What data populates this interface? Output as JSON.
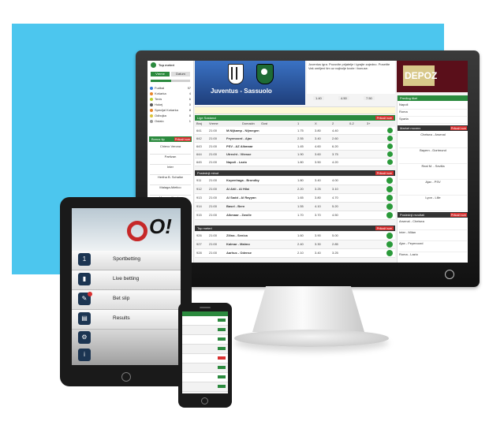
{
  "monitor": {
    "sidebar": {
      "title": "Top meteri",
      "tabs": [
        "Vreme",
        "Datum"
      ],
      "sports": [
        {
          "name": "Fudbal",
          "count": "87"
        },
        {
          "name": "Košarka",
          "count": "4"
        },
        {
          "name": "Tenis",
          "count": "6"
        },
        {
          "name": "Hokej",
          "count": "0"
        },
        {
          "name": "Specijal Košarka",
          "count": "8"
        },
        {
          "name": "Odbojka",
          "count": "8"
        },
        {
          "name": "Ostalo",
          "count": "1"
        }
      ],
      "bet_slip_title": "Bonus tip",
      "bet_slip_button": "Prikaži sve",
      "bet_slip_rows": [
        "Chievo Verona",
        "Partizan",
        "Inter",
        "Hertha B. Schalke",
        "Malaga Atletico",
        "Monaco Nantes"
      ]
    },
    "banner": {
      "match_title": "Juventus - Sassuolo",
      "promo_text": "Juventus igra. Pozovite prijatelje i igrajte zajedno. Posetite Vaš omiljeni tim uz najbolje kvote i bonuse.",
      "odds": [
        "1.40",
        "4.50",
        "7.50"
      ],
      "ad_text": "DEPOZ"
    },
    "sections": [
      {
        "title": "Lige Sastanci",
        "button": "Prikaži sve"
      },
      {
        "title": "Poslednji minut",
        "button": "Prikaži sve"
      },
      {
        "title": "Top meteri",
        "button": "Prikaži sve"
      }
    ],
    "table_header": [
      "Broj",
      "Vreme",
      "Domaćin",
      "Gost",
      "1",
      "X",
      "2",
      "0-2",
      "3+"
    ],
    "rows_top": [
      {
        "num": "641",
        "time": "21:00",
        "match": "M.Nijkamp - Nijmegen",
        "odds": [
          "1.75",
          "3.80",
          "4.40"
        ]
      },
      {
        "num": "642",
        "time": "21:00",
        "match": "Feyenoord - Ajax",
        "odds": [
          "2.55",
          "3.40",
          "2.60"
        ]
      },
      {
        "num": "643",
        "time": "21:00",
        "match": "PSV - AZ Alkmaar",
        "odds": [
          "1.45",
          "4.60",
          "6.20"
        ]
      },
      {
        "num": "644",
        "time": "21:00",
        "match": "Utrecht - Vitesse",
        "odds": [
          "1.90",
          "3.60",
          "3.75"
        ]
      },
      {
        "num": "645",
        "time": "21:00",
        "match": "Napoli - Lazio",
        "odds": [
          "1.80",
          "3.50",
          "4.20"
        ]
      }
    ],
    "rows_mid": [
      {
        "num": "911",
        "time": "21:00",
        "match": "Kopenhaga - Brondby",
        "odds": [
          "1.80",
          "3.40",
          "4.00"
        ]
      },
      {
        "num": "912",
        "time": "21:00",
        "match": "Al Ahli - Al Hilal",
        "odds": [
          "2.20",
          "3.25",
          "3.10"
        ]
      },
      {
        "num": "913",
        "time": "21:00",
        "match": "Al Sadd - Al Rayyan",
        "odds": [
          "1.65",
          "3.80",
          "4.70"
        ]
      },
      {
        "num": "914",
        "time": "21:00",
        "match": "Basel - Bern",
        "odds": [
          "1.55",
          "4.10",
          "5.20"
        ]
      },
      {
        "num": "915",
        "time": "21:00",
        "match": "Alkmaar - Zwolle",
        "odds": [
          "1.70",
          "3.70",
          "4.50"
        ]
      }
    ],
    "rows_bottom": [
      {
        "num": "926",
        "time": "21:00",
        "match": "Zilina - Senica",
        "odds": [
          "1.60",
          "3.90",
          "5.00"
        ]
      },
      {
        "num": "927",
        "time": "21:00",
        "match": "Kalmar - Malmo",
        "odds": [
          "2.40",
          "3.30",
          "2.85"
        ]
      },
      {
        "num": "928",
        "time": "21:00",
        "match": "Aarhus - Odense",
        "odds": [
          "2.10",
          "3.40",
          "3.25"
        ]
      }
    ],
    "right_panel": {
      "top_title": "Predlog tiket",
      "top_rows": [
        "Napoli",
        "Roma",
        "Sparta"
      ],
      "mid_title": "Market movers",
      "mid_button": "Prikaži sve",
      "mid_rows": [
        "Chelsea - Arsenal",
        "Bayern - Dortmund",
        "Real M. - Sevilla",
        "Ajax - PSV",
        "Lyon - Lille"
      ],
      "bottom_title": "Poslednji rezultati",
      "bottom_button": "Prikaži sve",
      "bottom_rows": [
        "Arsenal - Chelsea",
        "Inter - Milan",
        "Ajax - Feyenoord",
        "Roma - Lazio"
      ]
    }
  },
  "tablet": {
    "menu": [
      {
        "label": "Sportbetting",
        "icon": "ticket-icon"
      },
      {
        "label": "Live betting",
        "icon": "live-icon"
      },
      {
        "label": "Bet slip",
        "icon": "slip-icon"
      },
      {
        "label": "Results",
        "icon": "results-icon"
      },
      {
        "label": "Settings",
        "icon": "gear-icon"
      },
      {
        "label": "Info",
        "icon": "info-icon"
      }
    ],
    "logo_text": "O!"
  },
  "phone": {
    "rows": [
      "",
      "",
      "",
      "",
      "",
      "",
      ""
    ]
  },
  "colors": {
    "backdrop": "#4cc6ee",
    "accent_green": "#2b8a3e",
    "navy": "#1c3552"
  }
}
